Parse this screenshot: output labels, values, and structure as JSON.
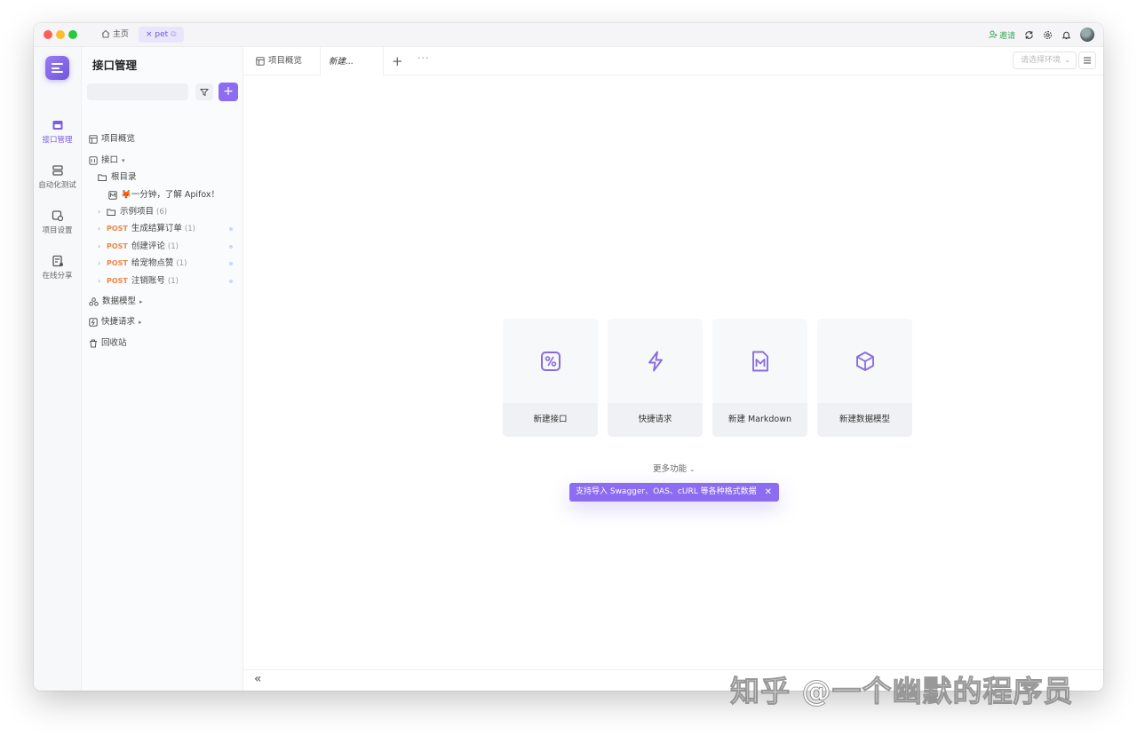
{
  "titlebar": {
    "home_label": "主页",
    "project_tab_label": "pet",
    "invite_label": "邀请"
  },
  "rail": {
    "items": [
      {
        "label": "接口管理",
        "active": true
      },
      {
        "label": "自动化测试",
        "active": false
      },
      {
        "label": "项目设置",
        "active": false
      },
      {
        "label": "在线分享",
        "active": false
      }
    ]
  },
  "sidebar": {
    "title": "接口管理",
    "search_value": "",
    "tree": {
      "overview": "项目概览",
      "interfaces": "接口",
      "root_dir": "根目录",
      "intro_doc": "🦊一分钟，了解 Apifox！",
      "example_folder": "示例项目",
      "example_count": "(6)",
      "posts": [
        {
          "method": "POST",
          "name": "生成结算订单",
          "count": "(1)"
        },
        {
          "method": "POST",
          "name": "创建评论",
          "count": "(1)"
        },
        {
          "method": "POST",
          "name": "给宠物点赞",
          "count": "(1)"
        },
        {
          "method": "POST",
          "name": "注销账号",
          "count": "(1)"
        }
      ],
      "data_models": "数据模型",
      "quick_requests": "快捷请求",
      "recycle_bin": "回收站"
    }
  },
  "main": {
    "tabs": [
      {
        "label": "项目概览"
      },
      {
        "label": "新建..."
      }
    ],
    "env_placeholder": "请选择环境",
    "cards": [
      {
        "label": "新建接口",
        "icon": "api-icon"
      },
      {
        "label": "快捷请求",
        "icon": "lightning-icon"
      },
      {
        "label": "新建 Markdown",
        "icon": "markdown-icon"
      },
      {
        "label": "新建数据模型",
        "icon": "cube-icon"
      }
    ],
    "more_functions": "更多功能",
    "tip": "支持导入 Swagger、OAS、cURL 等各种格式数据"
  },
  "watermark": "知乎 @一个幽默的程序员",
  "colors": {
    "accent": "#8c6cf0",
    "post_method": "#e8884a",
    "invite": "#3aa657"
  }
}
